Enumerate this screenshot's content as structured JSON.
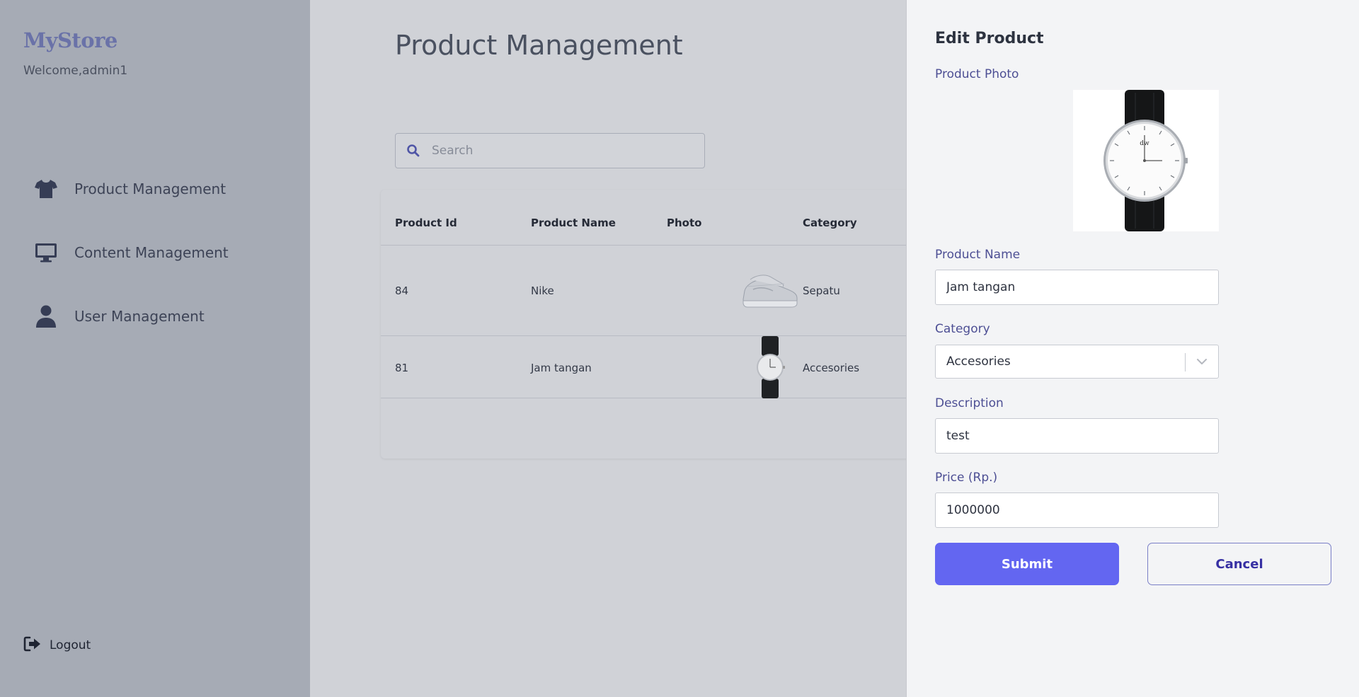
{
  "sidebar": {
    "brand": "MyStore",
    "welcome": "Welcome,admin1",
    "items": [
      {
        "label": "Product Management",
        "icon": "shirt-icon"
      },
      {
        "label": "Content Management",
        "icon": "monitor-icon"
      },
      {
        "label": "User Management",
        "icon": "user-icon"
      }
    ],
    "logout_label": "Logout"
  },
  "main": {
    "title": "Product Management",
    "search_placeholder": "Search",
    "search_value": "",
    "table": {
      "headers": [
        "Product Id",
        "Product Name",
        "Photo",
        "Category"
      ],
      "rows": [
        {
          "id": "84",
          "name": "Nike",
          "photo": "sneaker-image",
          "category": "Sepatu"
        },
        {
          "id": "81",
          "name": "Jam tangan",
          "photo": "watch-image",
          "category": "Accesories"
        }
      ]
    }
  },
  "panel": {
    "title": "Edit Product",
    "photo_label": "Product Photo",
    "name_label": "Product Name",
    "name_value": "Jam tangan",
    "category_label": "Category",
    "category_value": "Accesories",
    "description_label": "Description",
    "description_value": "test",
    "price_label": "Price (Rp.)",
    "price_value": "1000000",
    "submit_label": "Submit",
    "cancel_label": "Cancel"
  },
  "colors": {
    "accent": "#6366f1",
    "label": "#4d4f94",
    "sidebar_bg": "#a6abb5",
    "overlay_bg": "#d0d2d7"
  }
}
